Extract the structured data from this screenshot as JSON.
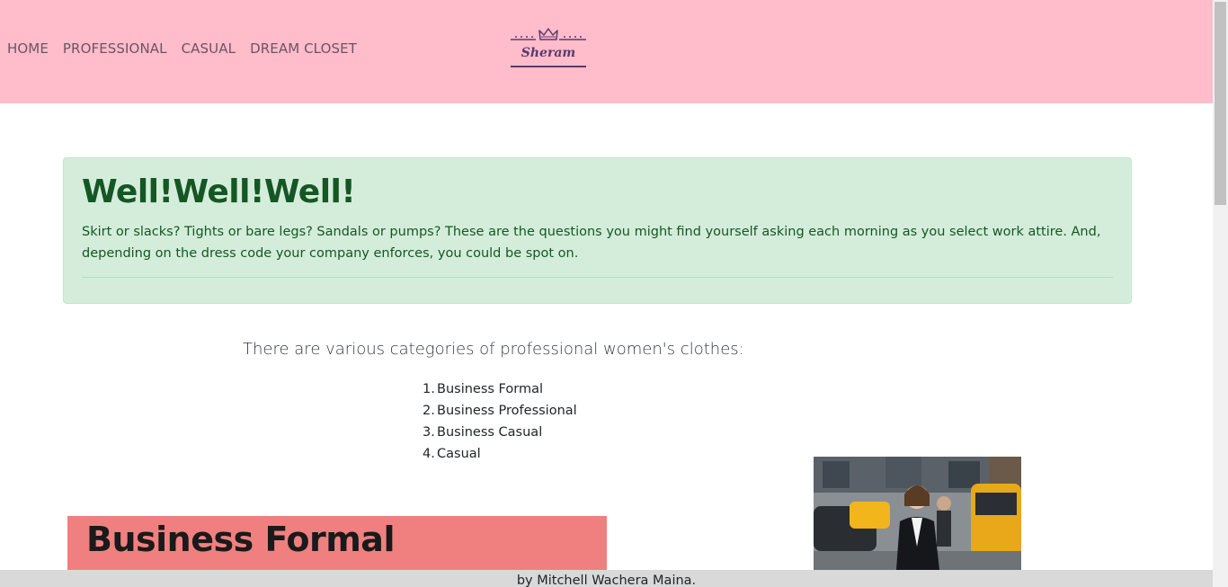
{
  "nav": {
    "items": [
      {
        "label": "HOME"
      },
      {
        "label": "PROFESSIONAL"
      },
      {
        "label": "CASUAL"
      },
      {
        "label": "DREAM CLOSET"
      }
    ],
    "logo_text": "Sheram",
    "background": "#ffbccb"
  },
  "alert": {
    "heading": "Well!Well!Well!",
    "text": "Skirt or slacks? Tights or bare legs? Sandals or pumps? These are the questions you might find yourself asking each morning as you select work attire. And, depending on the dress code your company enforces, you could be spot on.",
    "background": "#d4edda"
  },
  "intro": "There are various categories of professional women's clothes:",
  "categories": [
    {
      "num": "1.",
      "label": "Business Formal"
    },
    {
      "num": "2.",
      "label": "Business Professional"
    },
    {
      "num": "3.",
      "label": "Business Casual"
    },
    {
      "num": "4.",
      "label": "Casual"
    }
  ],
  "section": {
    "title": "Business Formal",
    "background": "#f08080"
  },
  "footer": {
    "text": "by Mitchell Wachera Maina."
  }
}
